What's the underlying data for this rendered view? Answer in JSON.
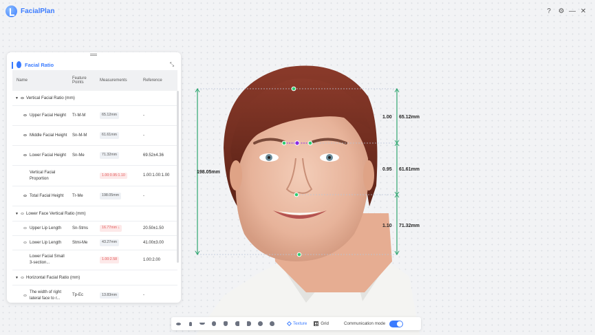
{
  "app": {
    "title": "FacialPlan"
  },
  "window_controls": {
    "help": "?",
    "settings": "⚙",
    "minimize": "—",
    "close": "✕"
  },
  "panel": {
    "title": "Facial Ratio",
    "columns": {
      "name": "Name",
      "feature_points": "Feature Points",
      "measurements": "Measurements",
      "reference": "Reference"
    },
    "groups": [
      {
        "label": "Vertical Facial Ratio (mm)",
        "rows": [
          {
            "name": "Upper Facial Height",
            "fp": "Tr-M-M",
            "meas": "65.12mm",
            "warn": false,
            "ref": "-"
          },
          {
            "name": "Middle Facial Height",
            "fp": "Sn-M-M",
            "meas": "61.61mm",
            "warn": false,
            "ref": "-"
          },
          {
            "name": "Lower Facial Height",
            "fp": "Sn-Me",
            "meas": "71.32mm",
            "warn": false,
            "ref": "69.52±4.36"
          },
          {
            "name": "Vertical Facial Proportion",
            "fp": "",
            "meas": "1.00:0.95:1.10",
            "warn": true,
            "ref": "1.00:1.00:1.00"
          },
          {
            "name": "Total Facial Height",
            "fp": "Tr-Me",
            "meas": "198.05mm",
            "warn": false,
            "ref": "-"
          }
        ]
      },
      {
        "label": "Lower Face Vertical Ratio (mm)",
        "rows": [
          {
            "name": "Upper Lip Length",
            "fp": "Sn-Stms",
            "meas": "16.77mm ↓",
            "warn": true,
            "ref": "20.50±1.50"
          },
          {
            "name": "Lower Lip Length",
            "fp": "Stmi-Me",
            "meas": "43.27mm",
            "warn": false,
            "ref": "41.00±3.00"
          },
          {
            "name": "Lower Facial Small 3-section...",
            "fp": "",
            "meas": "1.00:2.58",
            "warn": true,
            "ref": "1.00:2.00"
          }
        ]
      },
      {
        "label": "Horizontal Facial Ratio (mm)",
        "rows": [
          {
            "name": "The width of right lateral face to r...",
            "fp": "Tp-Ec",
            "meas": "13.83mm",
            "warn": false,
            "ref": "-"
          }
        ]
      }
    ]
  },
  "annotations": {
    "total_height": "198.05mm",
    "upper_ratio": "1.00",
    "upper_mm": "65.12mm",
    "middle_ratio": "0.95",
    "middle_mm": "61.61mm",
    "lower_ratio": "1.10",
    "lower_mm": "71.32mm"
  },
  "toolbar": {
    "view_icons": [
      "eye-icon",
      "nose-icon",
      "lips-icon",
      "face-front-icon",
      "face-shape-icon",
      "profile-left-icon",
      "profile-right-icon",
      "head-icon",
      "head-side-icon"
    ],
    "texture_label": "Texture",
    "grid_label": "Grid",
    "communication_label": "Communication mode",
    "communication_on": true
  },
  "colors": {
    "accent": "#3a7bff",
    "measure_line": "#2ea56f",
    "warn": "#e25a5a",
    "landmark_mid": "#8a2be2"
  }
}
